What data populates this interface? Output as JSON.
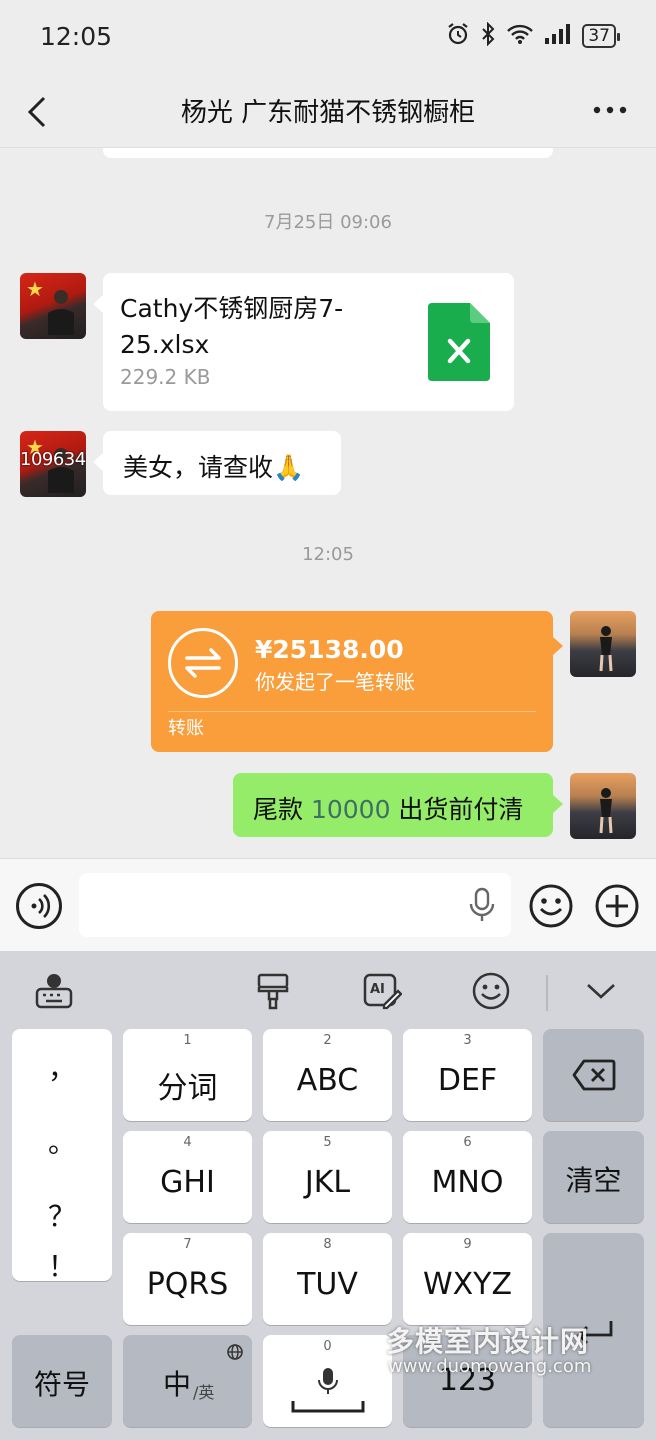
{
  "status_bar": {
    "time": "12:05",
    "battery": "37",
    "icons": [
      "alarm-icon",
      "bluetooth-icon",
      "wifi-icon",
      "signal-icon",
      "battery-icon"
    ]
  },
  "header": {
    "title": "杨光 广东耐猫不锈钢橱柜"
  },
  "chat": {
    "messages": [
      {
        "type": "timestamp",
        "text": "7月25日 09:06"
      },
      {
        "type": "file",
        "side": "left",
        "file_name": "Cathy不锈钢厨房7-25.xlsx",
        "file_size": "229.2 KB",
        "file_icon": "excel-icon"
      },
      {
        "type": "text",
        "side": "left",
        "text": "美女，请查收🙏",
        "avatar_overlay": "109634"
      },
      {
        "type": "timestamp",
        "text": "12:05"
      },
      {
        "type": "transfer",
        "side": "right",
        "amount": "¥25138.00",
        "description": "你发起了一笔转账",
        "label": "转账"
      },
      {
        "type": "text",
        "side": "right",
        "text_before": "尾款 ",
        "number": "10000",
        "text_after": " 出货前付清"
      }
    ]
  },
  "input_bar": {
    "placeholder": "",
    "value": ""
  },
  "keyboard": {
    "toolbar": [
      "keyboard-globe-icon",
      "brush-icon",
      "ai-edit-icon",
      "emoji-icon",
      "collapse-icon"
    ],
    "punctuation": [
      "，",
      "。",
      "？",
      "！"
    ],
    "keys": [
      {
        "sub": "1",
        "label": "分词"
      },
      {
        "sub": "2",
        "label": "ABC"
      },
      {
        "sub": "3",
        "label": "DEF"
      },
      {
        "sub": "4",
        "label": "GHI"
      },
      {
        "sub": "5",
        "label": "JKL"
      },
      {
        "sub": "6",
        "label": "MNO"
      },
      {
        "sub": "7",
        "label": "PQRS"
      },
      {
        "sub": "8",
        "label": "TUV"
      },
      {
        "sub": "9",
        "label": "WXYZ"
      }
    ],
    "clear_label": "清空",
    "symbols_label": "符号",
    "lang_label": "中",
    "lang_sub": "/英",
    "space_sub": "0",
    "num_label": "123"
  },
  "watermark": {
    "text": "多模室内设计网",
    "url": "www.duomowang.com"
  },
  "colors": {
    "background": "#ededed",
    "bubble_green": "#95ec69",
    "transfer_orange": "#fa9d3b",
    "excel_green": "#1aad4e"
  }
}
